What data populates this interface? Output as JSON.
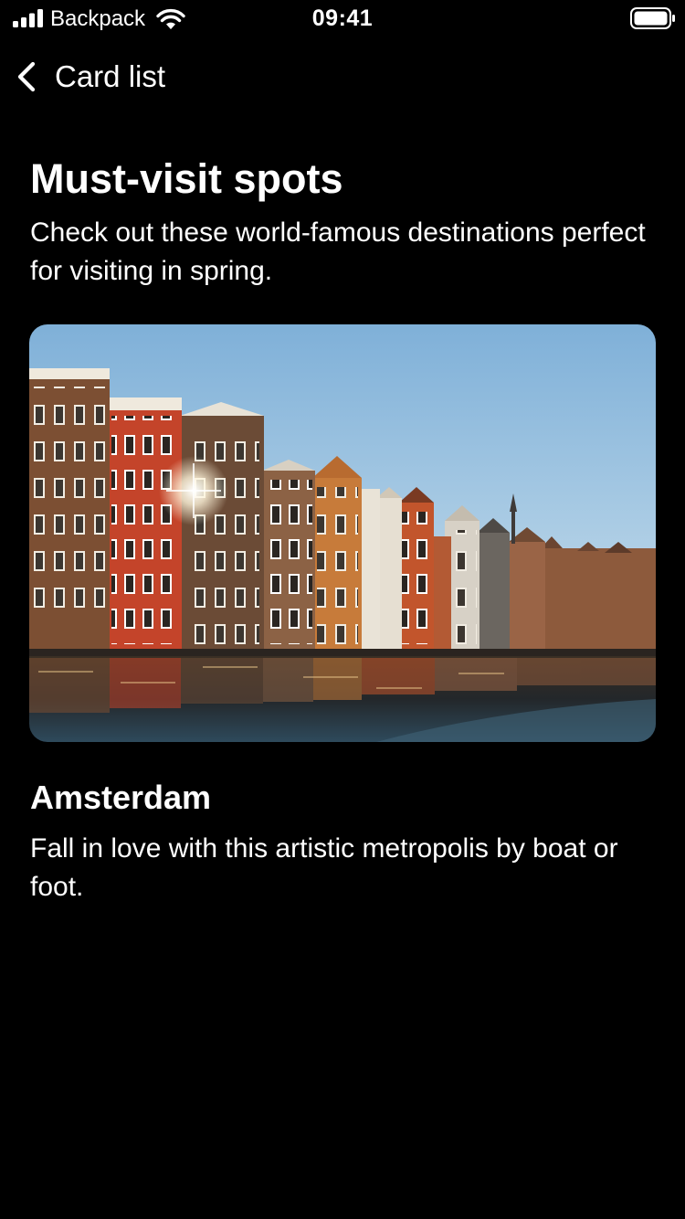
{
  "status_bar": {
    "carrier": "Backpack",
    "time": "09:41",
    "icons": [
      "signal-icon",
      "wifi-icon",
      "battery-icon"
    ]
  },
  "nav": {
    "back_label": "Card list",
    "back_icon": "chevron-left-icon"
  },
  "page": {
    "title": "Must-visit spots",
    "subtitle": "Check out these world-famous destinations perfect for visiting in spring."
  },
  "card": {
    "image_subject": "canal-houses-photo",
    "title": "Amsterdam",
    "description": "Fall in love with this artistic metropolis by boat or foot."
  },
  "colors": {
    "background": "#000000",
    "text": "#ffffff",
    "sky": "#9cc3e0",
    "water": "#1d2a33"
  }
}
